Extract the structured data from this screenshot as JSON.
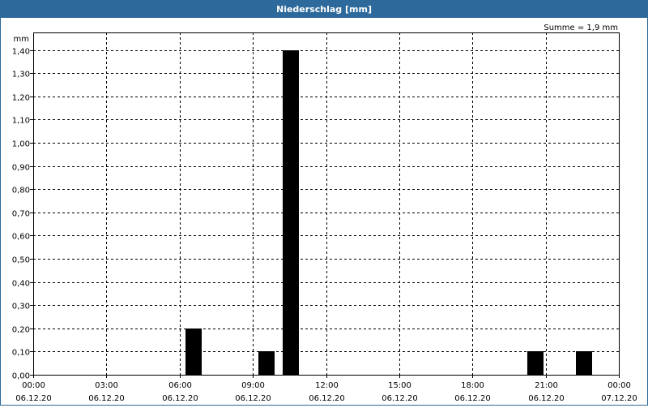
{
  "window": {
    "title": "Niederschlag [mm]"
  },
  "chart_data": {
    "type": "bar",
    "title": "Niederschlag [mm]",
    "ylabel": "mm",
    "sum_label": "Summe = 1,9 mm",
    "ylim": [
      0,
      1.45
    ],
    "y_ticks": [
      0,
      0.1,
      0.2,
      0.3,
      0.4,
      0.5,
      0.6,
      0.7,
      0.8,
      0.9,
      1.0,
      1.1,
      1.2,
      1.3,
      1.4
    ],
    "y_tick_labels": [
      "0,00",
      "0,10",
      "0,20",
      "0,30",
      "0,40",
      "0,50",
      "0,60",
      "0,70",
      "0,80",
      "0,90",
      "1,00",
      "1,10",
      "1,20",
      "1,30",
      "1,40"
    ],
    "x_range_hours": [
      0,
      24
    ],
    "x_ticks": [
      {
        "hour": 0,
        "time": "00:00",
        "date": "06.12.20"
      },
      {
        "hour": 3,
        "time": "03:00",
        "date": "06.12.20"
      },
      {
        "hour": 6,
        "time": "06:00",
        "date": "06.12.20"
      },
      {
        "hour": 9,
        "time": "09:00",
        "date": "06.12.20"
      },
      {
        "hour": 12,
        "time": "12:00",
        "date": "06.12.20"
      },
      {
        "hour": 15,
        "time": "15:00",
        "date": "06.12.20"
      },
      {
        "hour": 18,
        "time": "18:00",
        "date": "06.12.20"
      },
      {
        "hour": 21,
        "time": "21:00",
        "date": "06.12.20"
      },
      {
        "hour": 24,
        "time": "00:00",
        "date": "07.12.20"
      }
    ],
    "bars": [
      {
        "hour": 7,
        "value": 0.2
      },
      {
        "hour": 10,
        "value": 0.1
      },
      {
        "hour": 11,
        "value": 1.4
      },
      {
        "hour": 21,
        "value": 0.1
      },
      {
        "hour": 23,
        "value": 0.1
      }
    ],
    "grid": true,
    "colors": {
      "bar": "#000000",
      "title_bar": "#2d6a9b",
      "grid": "#000000"
    }
  }
}
